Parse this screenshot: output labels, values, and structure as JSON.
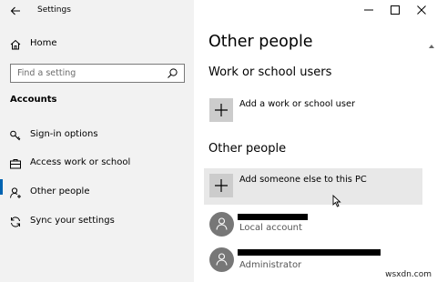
{
  "window": {
    "title": "Settings",
    "controls": {
      "minimize_icon": "minimize-icon",
      "maximize_icon": "maximize-icon",
      "close_icon": "close-icon"
    }
  },
  "sidebar": {
    "home_label": "Home",
    "search_placeholder": "Find a setting",
    "section_title": "Accounts",
    "items": [
      {
        "label": "Sign-in options",
        "icon": "key-icon"
      },
      {
        "label": "Access work or school",
        "icon": "briefcase-icon"
      },
      {
        "label": "Other people",
        "icon": "person-add-icon",
        "selected": true
      },
      {
        "label": "Sync your settings",
        "icon": "sync-icon"
      }
    ],
    "accent_color": "#0063b1"
  },
  "main": {
    "title": "Other people",
    "work_section_title": "Work or school users",
    "add_work_label": "Add a work or school user",
    "other_section_title": "Other people",
    "add_other_label": "Add someone else to this PC",
    "users": [
      {
        "name_redacted": true,
        "role": "Local account"
      },
      {
        "name_redacted": true,
        "role": "Administrator"
      }
    ]
  },
  "watermark": "wsxdn.com"
}
